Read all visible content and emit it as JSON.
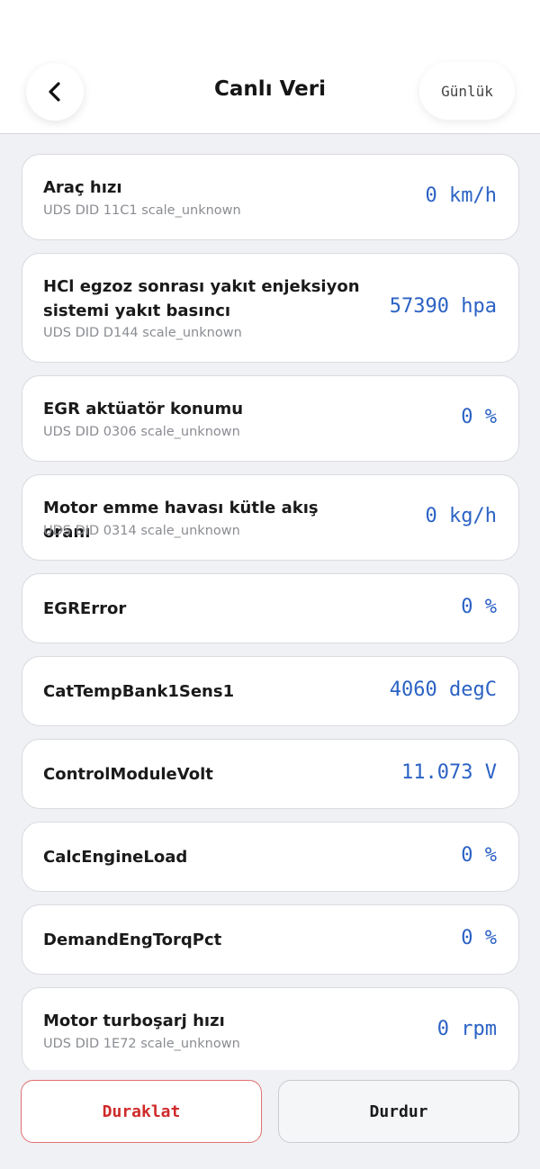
{
  "header": {
    "title": "Canlı Veri",
    "log_label": "Günlük"
  },
  "items": [
    {
      "label": "Araç hızı",
      "sub": "UDS DID 11C1 scale_unknown",
      "value": "0 km/h"
    },
    {
      "label": "HCl egzoz sonrası yakıt enjeksiyon sistemi yakıt basıncı",
      "sub": "UDS DID D144 scale_unknown",
      "value": "57390 hpa"
    },
    {
      "label": "EGR aktüatör konumu",
      "sub": "UDS DID 0306 scale_unknown",
      "value": "0 %"
    },
    {
      "label": "Motor emme havası kütle akış oranı",
      "sub": "UDS DID 0314 scale_unknown",
      "value": "0 kg/h"
    },
    {
      "label": "EGRError",
      "sub": "",
      "value": "0 %"
    },
    {
      "label": "CatTempBank1Sens1",
      "sub": "",
      "value": "4060 degC"
    },
    {
      "label": "ControlModuleVolt",
      "sub": "",
      "value": "11.073 V"
    },
    {
      "label": "CalcEngineLoad",
      "sub": "",
      "value": "0 %"
    },
    {
      "label": "DemandEngTorqPct",
      "sub": "",
      "value": "0 %"
    },
    {
      "label": "Motor turboşarj hızı",
      "sub": "UDS DID 1E72 scale_unknown",
      "value": "0 rpm"
    }
  ],
  "footer": {
    "pause_label": "Duraklat",
    "stop_label": "Durdur"
  },
  "colors": {
    "value": "#2b62c4",
    "pause": "#cf2a2a",
    "background": "#f0f1f4"
  }
}
